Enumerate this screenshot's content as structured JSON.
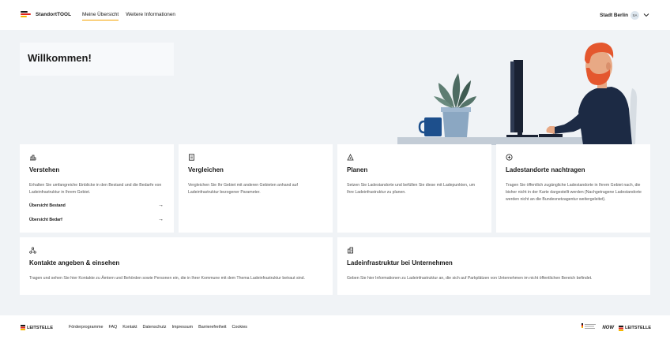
{
  "header": {
    "brand_bold": "StandortTOOL",
    "nav": [
      "Meine Übersicht",
      "Weitere Informationen"
    ],
    "user_name": "Stadt Berlin",
    "avatar_initials": "SA"
  },
  "welcome": {
    "title": "Willkommen!"
  },
  "cards": {
    "verstehen": {
      "title": "Verstehen",
      "text": "Erhalten Sie umfangreiche Einblicke in den Bestand und die Bedarfe von Ladeinfrastruktur in Ihrem Gebiet.",
      "link1": "Übersicht Bestand",
      "link2": "Übersicht Bedarf"
    },
    "vergleichen": {
      "title": "Vergleichen",
      "text": "Vergleichen Sie Ihr Gebiet mit anderen Gebieten anhand auf Ladeinfrastruktur bezogener Parameter."
    },
    "planen": {
      "title": "Planen",
      "text": "Setzen Sie Ladestandorte und befüllen Sie diese mit Ladepunkten, um Ihre Ladeinfrastruktur zu planen."
    },
    "nachtragen": {
      "title": "Ladestandorte nachtragen",
      "text": "Tragen Sie öffentlich zugängliche Ladestandorte in Ihrem Gebiet nach, die bisher nicht in der Karte dargestellt werden (Nachgetragene Ladestandorte werden nicht an die Bundesnetzagentur weitergeleitet)."
    },
    "kontakte": {
      "title": "Kontakte angeben & einsehen",
      "text": "Tragen und sehen Sie hier Kontakte zu Ämtern und Behörden sowie Personen ein, die in Ihrer Kommune mit dem Thema Ladeinfrastruktur betraut sind."
    },
    "unternehmen": {
      "title": "Ladeinfrastruktur bei Unternehmen",
      "text": "Geben Sie hier Informationen zu Ladeinfrastruktur an, die sich auf Parkplätzen von Unternehmen im nicht öffentlichen Bereich befindet."
    }
  },
  "footer": {
    "brand": "LEITSTELLE",
    "links": [
      "Förderprogramme",
      "FAQ",
      "Kontakt",
      "Datenschutz",
      "Impressum",
      "Barrierefreiheit",
      "Cookies"
    ],
    "partner_now": "NOW",
    "partner_leitstelle": "LEITSTELLE"
  },
  "colors": {
    "accent": "#f5a300",
    "background": "#f0f3f6",
    "card": "#ffffff"
  },
  "icons": [
    "chart-icon",
    "list-icon",
    "pin-icon",
    "plus-circle-icon",
    "network-icon",
    "building-icon",
    "arrow-right-icon",
    "chevron-down-icon"
  ]
}
